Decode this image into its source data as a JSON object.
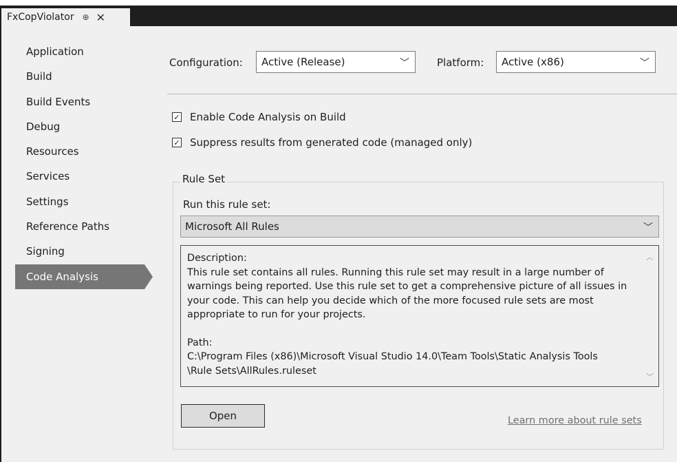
{
  "tab": {
    "title": "FxCopViolator",
    "pin_glyph": "⊕",
    "close_glyph": "✕"
  },
  "sidebar": {
    "items": [
      {
        "label": "Application"
      },
      {
        "label": "Build"
      },
      {
        "label": "Build Events"
      },
      {
        "label": "Debug"
      },
      {
        "label": "Resources"
      },
      {
        "label": "Services"
      },
      {
        "label": "Settings"
      },
      {
        "label": "Reference Paths"
      },
      {
        "label": "Signing"
      },
      {
        "label": "Code Analysis",
        "selected": true
      }
    ]
  },
  "config": {
    "configuration_label": "Configuration:",
    "configuration_value": "Active (Release)",
    "platform_label": "Platform:",
    "platform_value": "Active (x86)"
  },
  "options": {
    "enable_code_analysis": {
      "label": "Enable Code Analysis on Build",
      "checked": true
    },
    "suppress_generated": {
      "label": "Suppress results from generated code (managed only)",
      "checked": true
    }
  },
  "ruleset": {
    "group_title": "Rule Set",
    "run_label": "Run this rule set:",
    "selected": "Microsoft All Rules",
    "description_heading": "Description:",
    "description_body": "This rule set contains all rules. Running this rule set may result in a large number of warnings being reported. Use this rule set to get a comprehensive picture of all issues in your code. This can help you decide which of the more focused rule sets are most appropriate to run for your projects.",
    "path_heading": "Path:",
    "path_line1": "C:\\Program Files (x86)\\Microsoft Visual Studio 14.0\\Team Tools\\Static Analysis Tools",
    "path_line2": "\\Rule Sets\\AllRules.ruleset",
    "open_button": "Open",
    "learn_more": "Learn more about rule sets"
  },
  "theme": {
    "selected_nav_bg": "#767676",
    "panel_bg": "#f0f0f0",
    "titlebar_bg": "#1e1e1e"
  }
}
